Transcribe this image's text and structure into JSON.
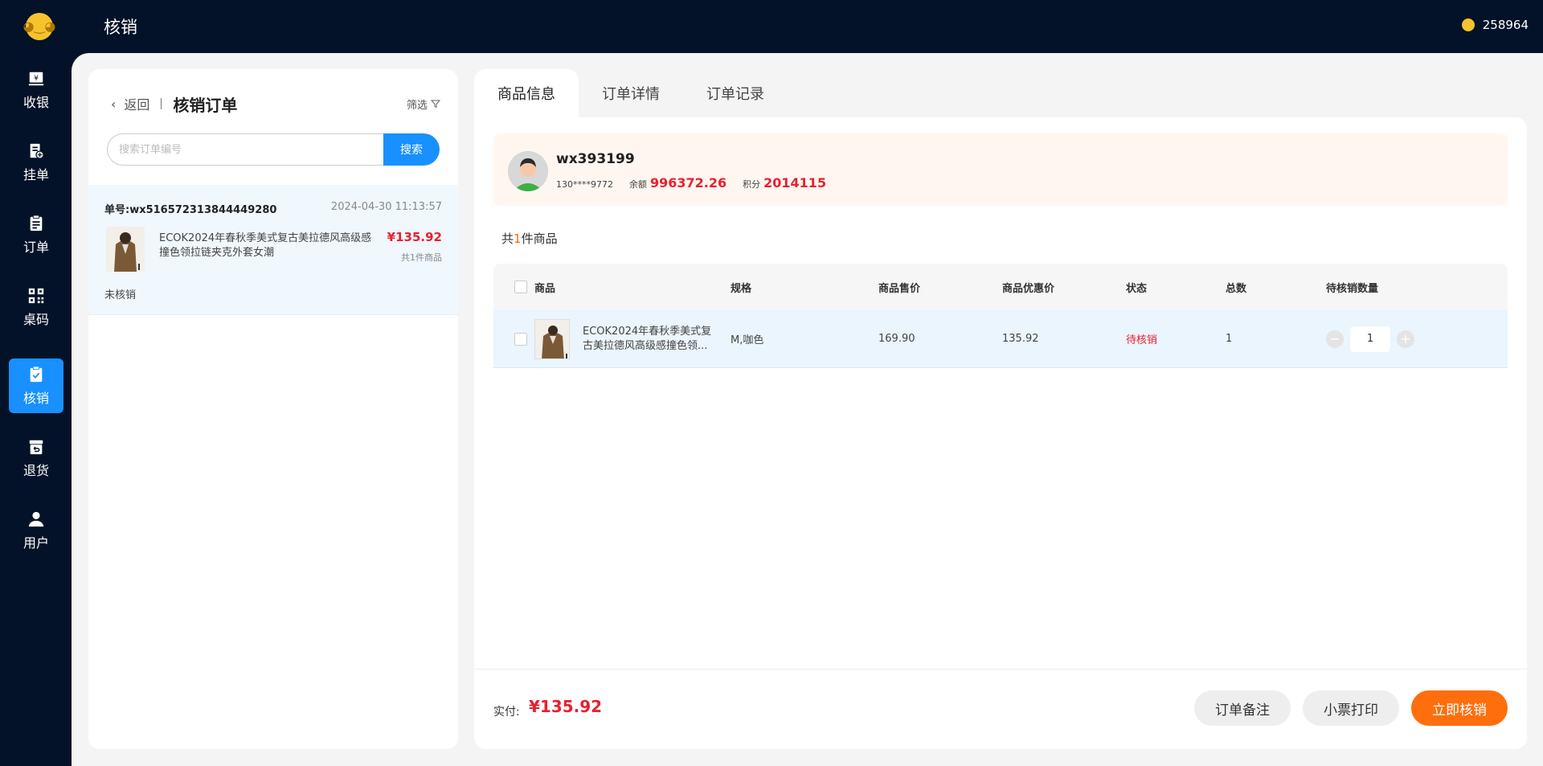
{
  "topbar": {
    "title": "核销",
    "coins": "258964"
  },
  "nav": [
    {
      "label": "收银",
      "icon": "cashier-icon"
    },
    {
      "label": "挂单",
      "icon": "hold-order-icon"
    },
    {
      "label": "订单",
      "icon": "order-icon"
    },
    {
      "label": "桌码",
      "icon": "qrcode-icon"
    },
    {
      "label": "核销",
      "icon": "verify-icon",
      "active": true
    },
    {
      "label": "退货",
      "icon": "return-icon"
    },
    {
      "label": "用户",
      "icon": "user-icon"
    }
  ],
  "left": {
    "back_label": "返回",
    "title": "核销订单",
    "filter_label": "筛选",
    "search_placeholder": "搜索订单编号",
    "search_button": "搜索",
    "order": {
      "number": "单号:wx516572313844449280",
      "time": "2024-04-30 11:13:57",
      "name": "ECOK2024年春秋季美式复古美拉德风高级感撞色领拉链夹克外套女潮",
      "price": "¥135.92",
      "count": "共1件商品",
      "status": "未核销"
    }
  },
  "tabs": [
    "商品信息",
    "订单详情",
    "订单记录"
  ],
  "member": {
    "name": "wx393199",
    "phone": "130****9772",
    "balance_label": "余额",
    "balance": "996372.26",
    "points_label": "积分",
    "points": "2014115"
  },
  "summary": {
    "prefix": "共",
    "count": "1",
    "suffix": "件商品"
  },
  "table": {
    "headers": {
      "product": "商品",
      "spec": "规格",
      "price": "商品售价",
      "discount": "商品优惠价",
      "status": "状态",
      "total": "总数",
      "pending": "待核销数量"
    },
    "row": {
      "name": "ECOK2024年春秋季美式复古美拉德风高级感撞色领...",
      "spec": "M,咖色",
      "price": "169.90",
      "discount": "135.92",
      "status": "待核销",
      "total": "1",
      "qty": "1"
    }
  },
  "footer": {
    "pay_label": "实付:",
    "pay_value": "¥135.92",
    "note_button": "订单备注",
    "print_button": "小票打印",
    "verify_button": "立即核销"
  },
  "colors": {
    "accent": "#1890ff",
    "orange": "#ff6e0d",
    "red": "#e8202f",
    "dark": "#031228"
  }
}
